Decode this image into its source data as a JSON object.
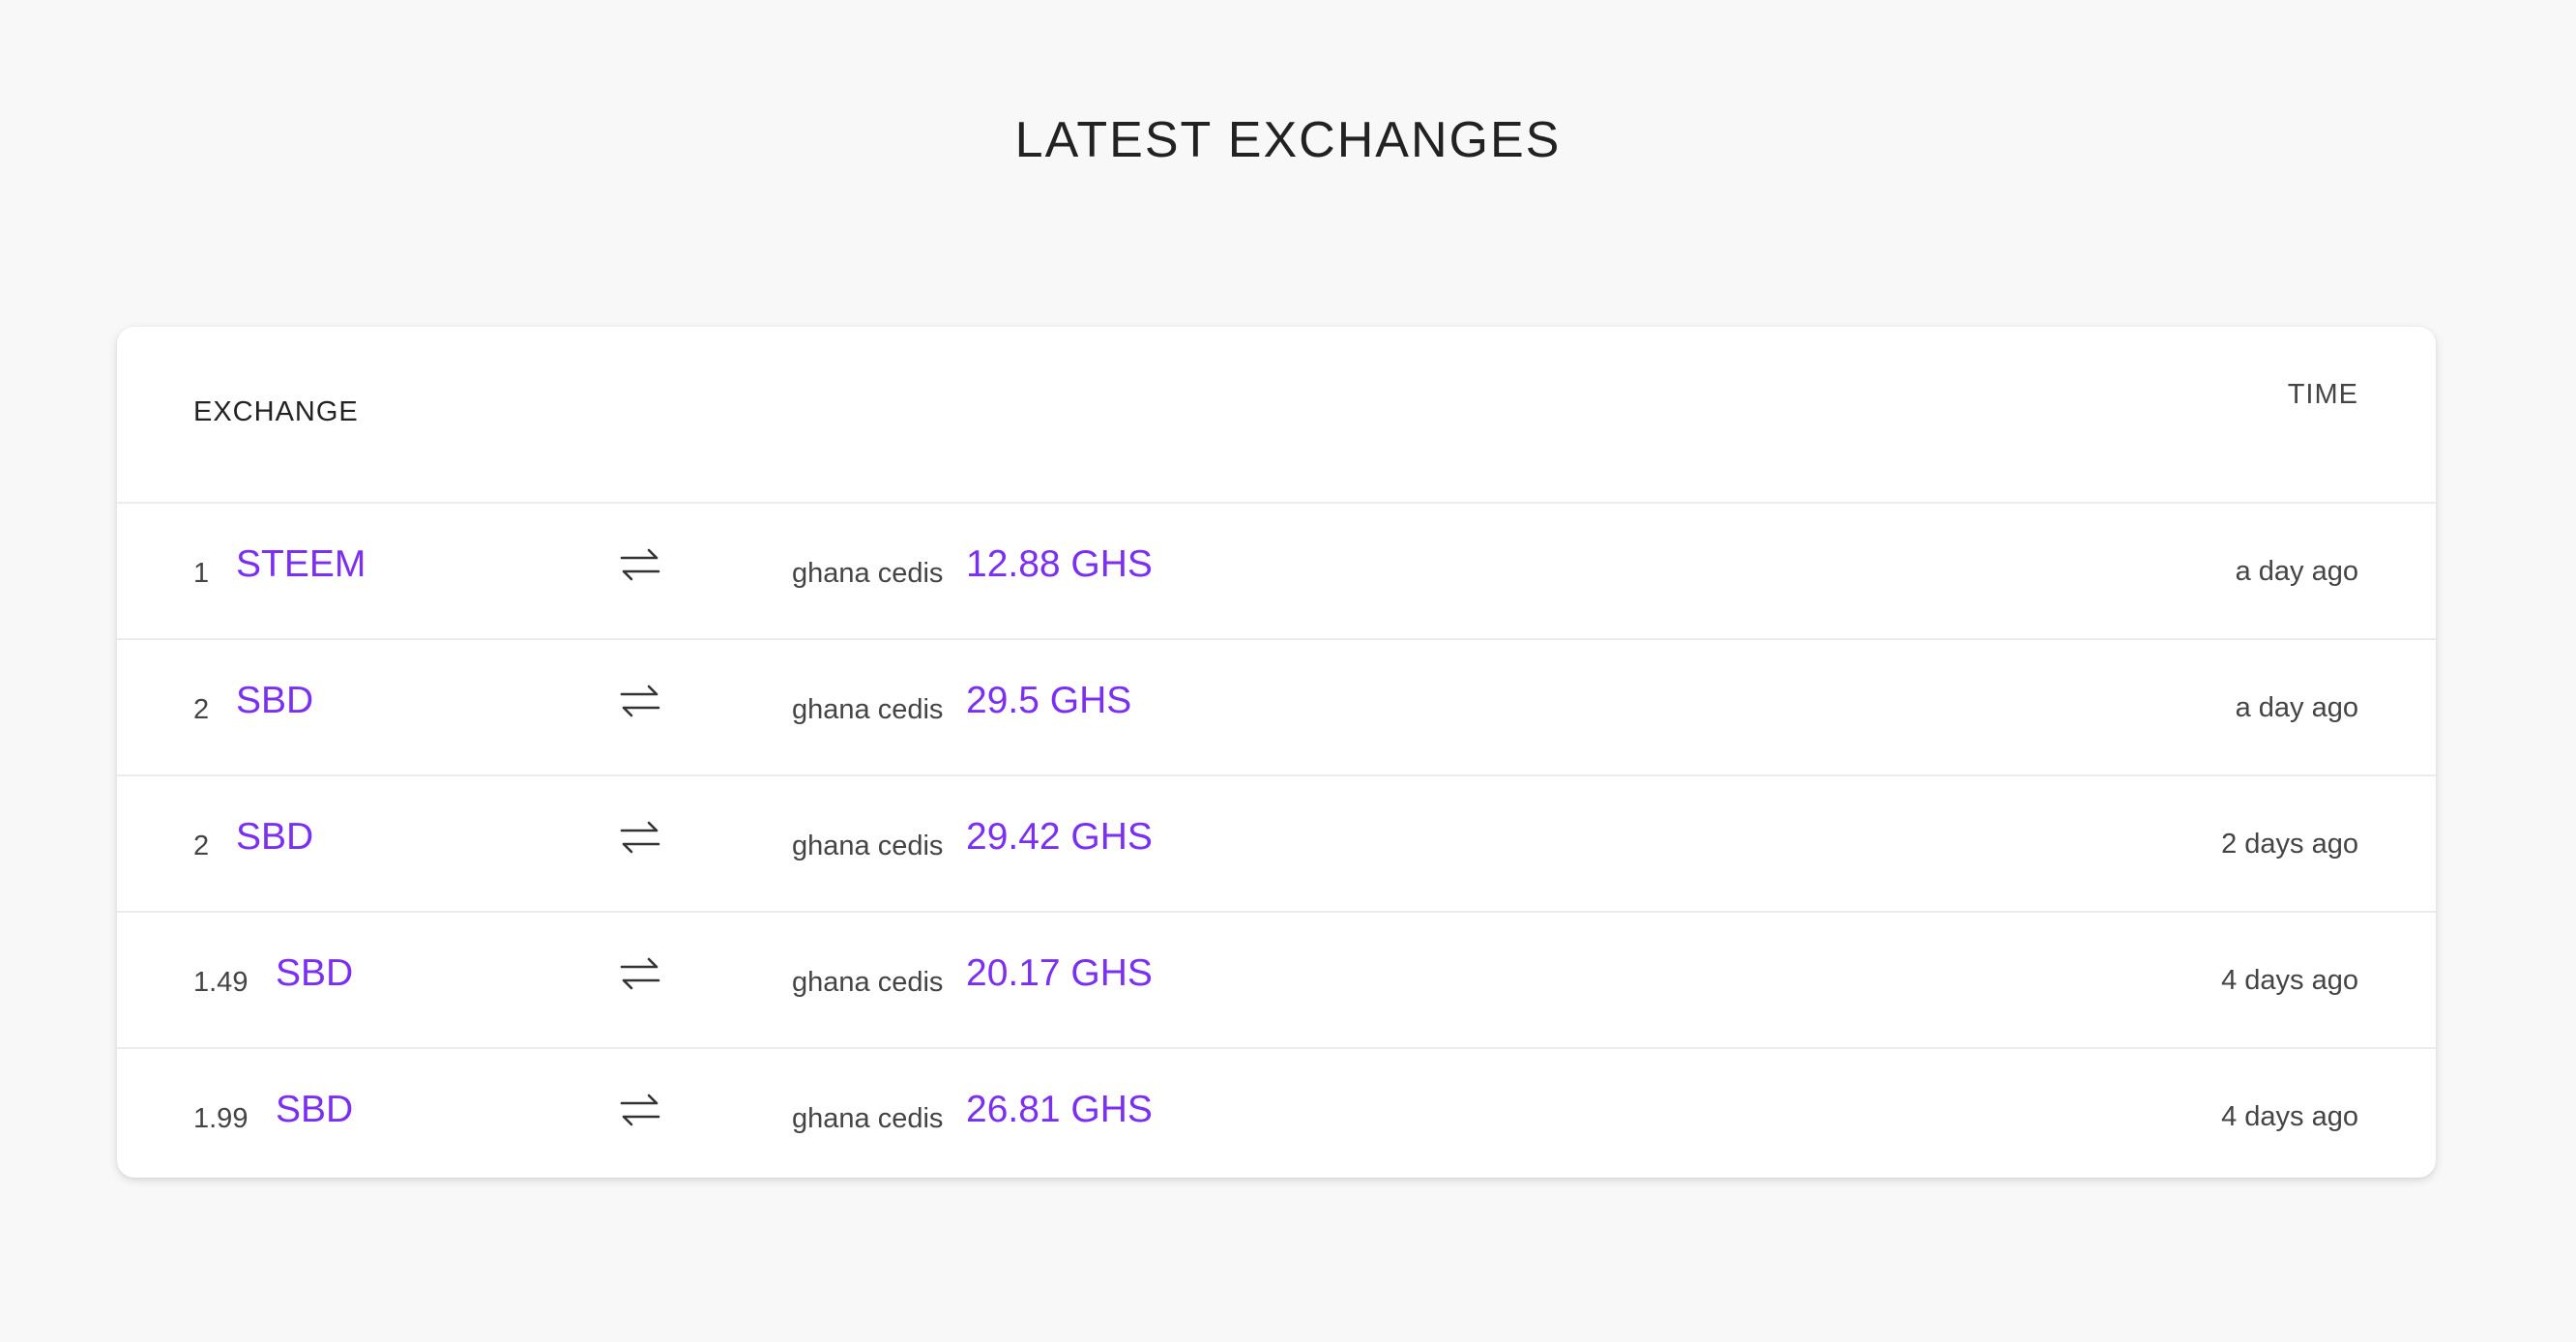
{
  "page": {
    "title": "LATEST EXCHANGES"
  },
  "table": {
    "headers": {
      "exchange": "EXCHANGE",
      "time": "TIME"
    },
    "rows": [
      {
        "qty": "1",
        "asset": "STEEM",
        "currency": "ghana cedis",
        "price": "12.88 GHS",
        "time": "a day ago"
      },
      {
        "qty": "2",
        "asset": "SBD",
        "currency": "ghana cedis",
        "price": "29.5 GHS",
        "time": "a day ago"
      },
      {
        "qty": "2",
        "asset": "SBD",
        "currency": "ghana cedis",
        "price": "29.42 GHS",
        "time": "2 days ago"
      },
      {
        "qty": "1.49",
        "asset": "SBD",
        "currency": "ghana cedis",
        "price": "20.17 GHS",
        "time": "4 days ago"
      },
      {
        "qty": "1.99",
        "asset": "SBD",
        "currency": "ghana cedis",
        "price": "26.81 GHS",
        "time": "4 days ago"
      }
    ]
  },
  "colors": {
    "accent": "#7b2ff2",
    "background": "#f8f8f8",
    "card": "#ffffff"
  },
  "icons": {
    "swap": "swap-arrows-icon"
  }
}
